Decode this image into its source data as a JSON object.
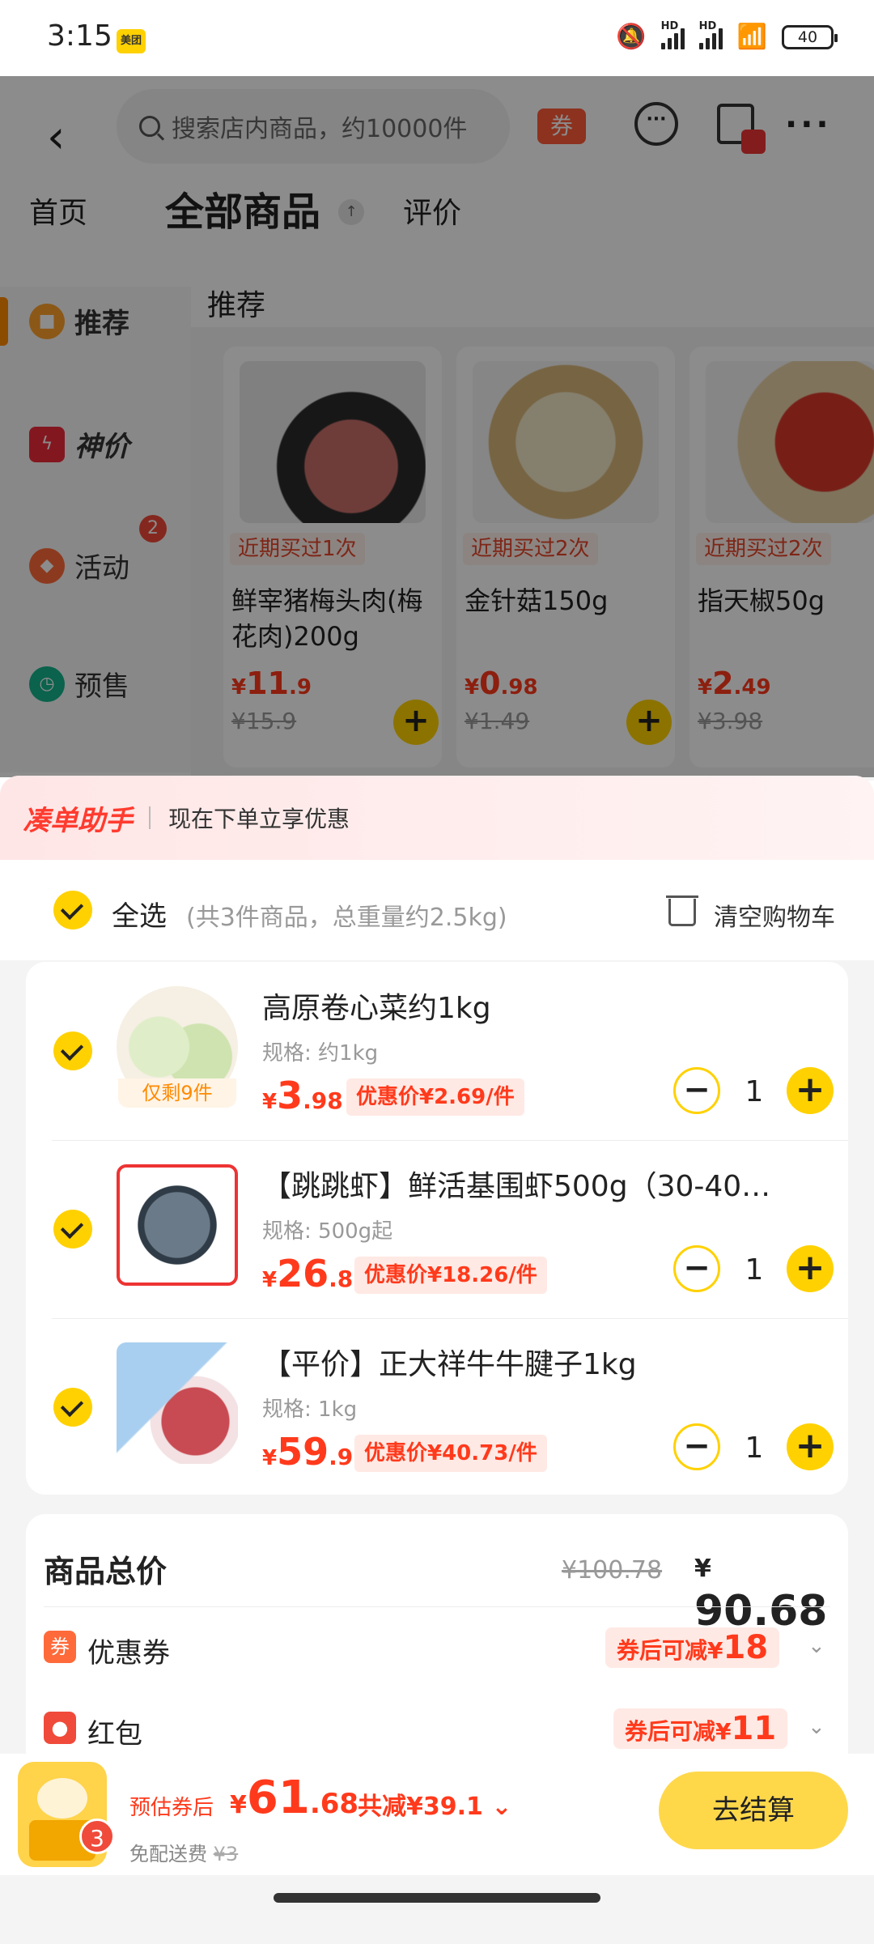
{
  "status_bar": {
    "time": "3:15",
    "app_badge": "美团",
    "battery": "40",
    "hd1": "HD",
    "hd2": "HD"
  },
  "store": {
    "search_placeholder": "搜索店内商品，约10000件",
    "coupon_tag": "券",
    "tabs": [
      {
        "label": "首页"
      },
      {
        "label": "全部商品"
      },
      {
        "label": "评价"
      }
    ],
    "pin_glyph": "↑",
    "section_title": "推荐",
    "nav": [
      {
        "label": "推荐",
        "color": "#ffa12b",
        "icon": "tag-icon"
      },
      {
        "label": "神价",
        "color": "#ee2b3b",
        "icon": "lightning-icon"
      },
      {
        "label": "活动",
        "color": "#ff6a3a",
        "icon": "gift-icon",
        "badge": "2"
      },
      {
        "label": "预售",
        "color": "#14b38c",
        "icon": "clock-icon"
      }
    ],
    "products": [
      {
        "badge": "近期买过1次",
        "name": "鲜宰猪梅头肉(梅花肉)200g",
        "price_cur": "¥",
        "price_int": "11",
        "price_dec": ".9",
        "orig": "¥15.9",
        "img_color": "#c9706b"
      },
      {
        "badge": "近期买过2次",
        "name": "金针菇150g",
        "price_cur": "¥",
        "price_int": "0",
        "price_dec": ".98",
        "orig": "¥1.49",
        "img_color": "#e8d9b0"
      },
      {
        "badge": "近期买过2次",
        "name": "指天椒50g",
        "price_cur": "¥",
        "price_int": "2",
        "price_dec": ".49",
        "orig": "¥3.98",
        "img_color": "#d93a2a"
      }
    ]
  },
  "cart": {
    "assistant_brand": "凑单助手",
    "assistant_text": "现在下单立享优惠",
    "select_all": "全选",
    "select_info": "(共3件商品，总重量约2.5kg)",
    "clear": "清空购物车",
    "items": [
      {
        "name": "高原卷心菜约1kg",
        "spec": "规格: 约1kg",
        "cur": "¥",
        "int": "3",
        "dec": ".98",
        "discount": "优惠价¥2.69/件",
        "qty": "1",
        "stock": "仅剩9件",
        "img_color": "#cfe3b0"
      },
      {
        "name": "【跳跳虾】鲜活基围虾500g（30-40…",
        "spec": "规格: 500g起",
        "cur": "¥",
        "int": "26",
        "dec": ".8",
        "discount": "优惠价¥18.26/件",
        "qty": "1",
        "img_color": "#6a7a88"
      },
      {
        "name": "【平价】正大祥牛牛腱子1kg",
        "spec": "规格: 1kg",
        "cur": "¥",
        "int": "59",
        "dec": ".9",
        "discount": "优惠价¥40.73/件",
        "qty": "1",
        "img_color": "#c84a52"
      }
    ],
    "summary": {
      "title": "商品总价",
      "orig": "¥100.78",
      "total_cur": "¥",
      "total": "90.68",
      "coupon_icon": "券",
      "coupon_label": "优惠券",
      "coupon_prefix": "券后可减",
      "coupon_cur": "¥",
      "coupon_value": "18",
      "redpacket_label": "红包",
      "redpacket_prefix": "券后可减",
      "redpacket_cur": "¥",
      "redpacket_value": "11"
    },
    "footer": {
      "est_label": "预估券后",
      "est_cur": "¥",
      "est_int": "61",
      "est_dec": ".68",
      "saved": "共减¥39.1",
      "delivery": "免配送费",
      "delivery_fee": "¥3",
      "cart_count": "3",
      "checkout": "去结算"
    }
  }
}
